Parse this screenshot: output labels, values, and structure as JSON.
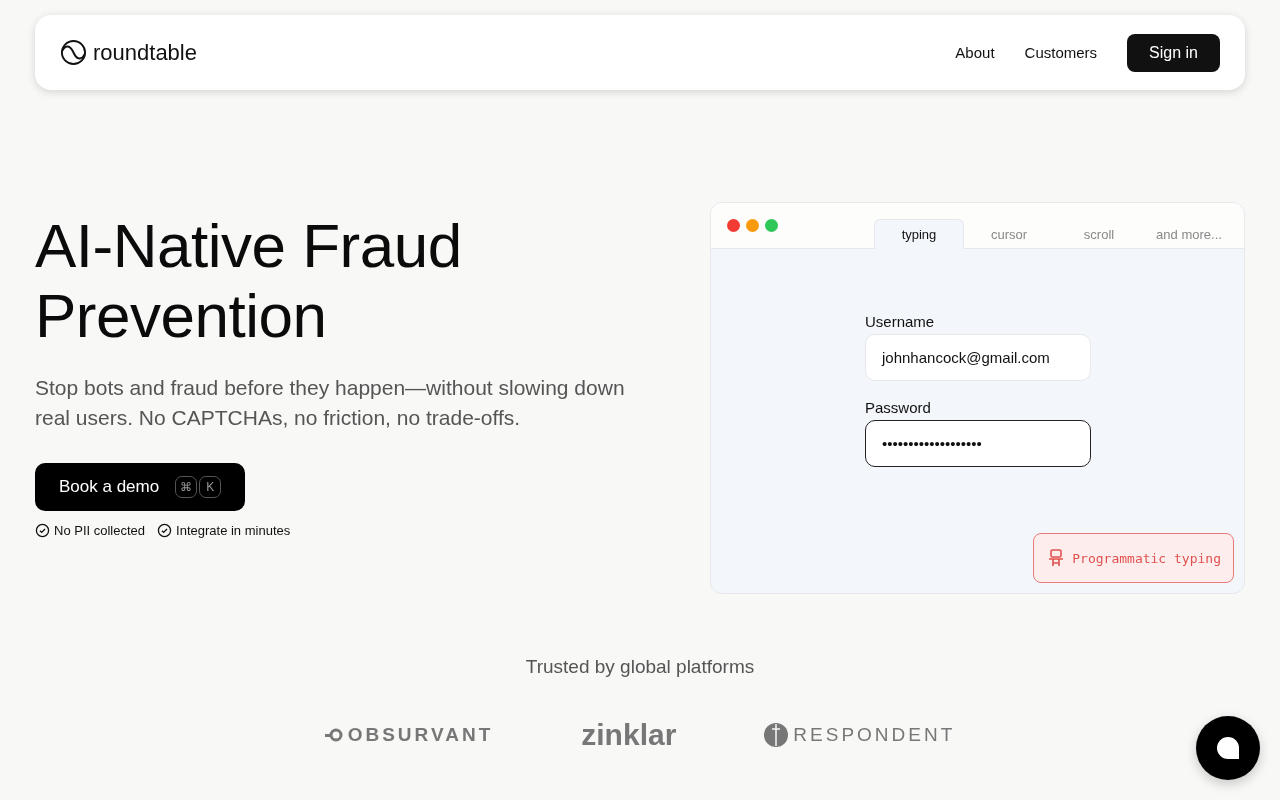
{
  "header": {
    "brand": "roundtable",
    "nav": [
      {
        "label": "About"
      },
      {
        "label": "Customers"
      }
    ],
    "cta": "Sign in"
  },
  "hero": {
    "title": "AI-Native Fraud Prevention",
    "subtitle": "Stop bots and fraud before they happen—without slowing down real users. No CAPTCHAs, no friction, no trade-offs.",
    "button": "Book a demo",
    "keys": [
      "⌘",
      "K"
    ],
    "features": [
      "No PII collected",
      "Integrate in minutes"
    ]
  },
  "demo": {
    "tabs": [
      {
        "label": "typing",
        "selected": true
      },
      {
        "label": "cursor",
        "selected": false
      },
      {
        "label": "scroll",
        "selected": false
      },
      {
        "label": "and more...",
        "selected": false
      }
    ],
    "fields": [
      {
        "label": "Username",
        "value": "johnhancock@gmail.com",
        "focused": false
      },
      {
        "label": "Password",
        "value": "•••••••••••••••••••",
        "focused": true
      }
    ],
    "alert": "Programmatic typing"
  },
  "trusted": {
    "heading": "Trusted by global platforms",
    "logos": [
      {
        "kind": "obsurvant",
        "name": "OBSURVANT"
      },
      {
        "kind": "zinklar",
        "name": "zinklar"
      },
      {
        "kind": "respondent",
        "name": "RESPONDENT"
      }
    ]
  }
}
